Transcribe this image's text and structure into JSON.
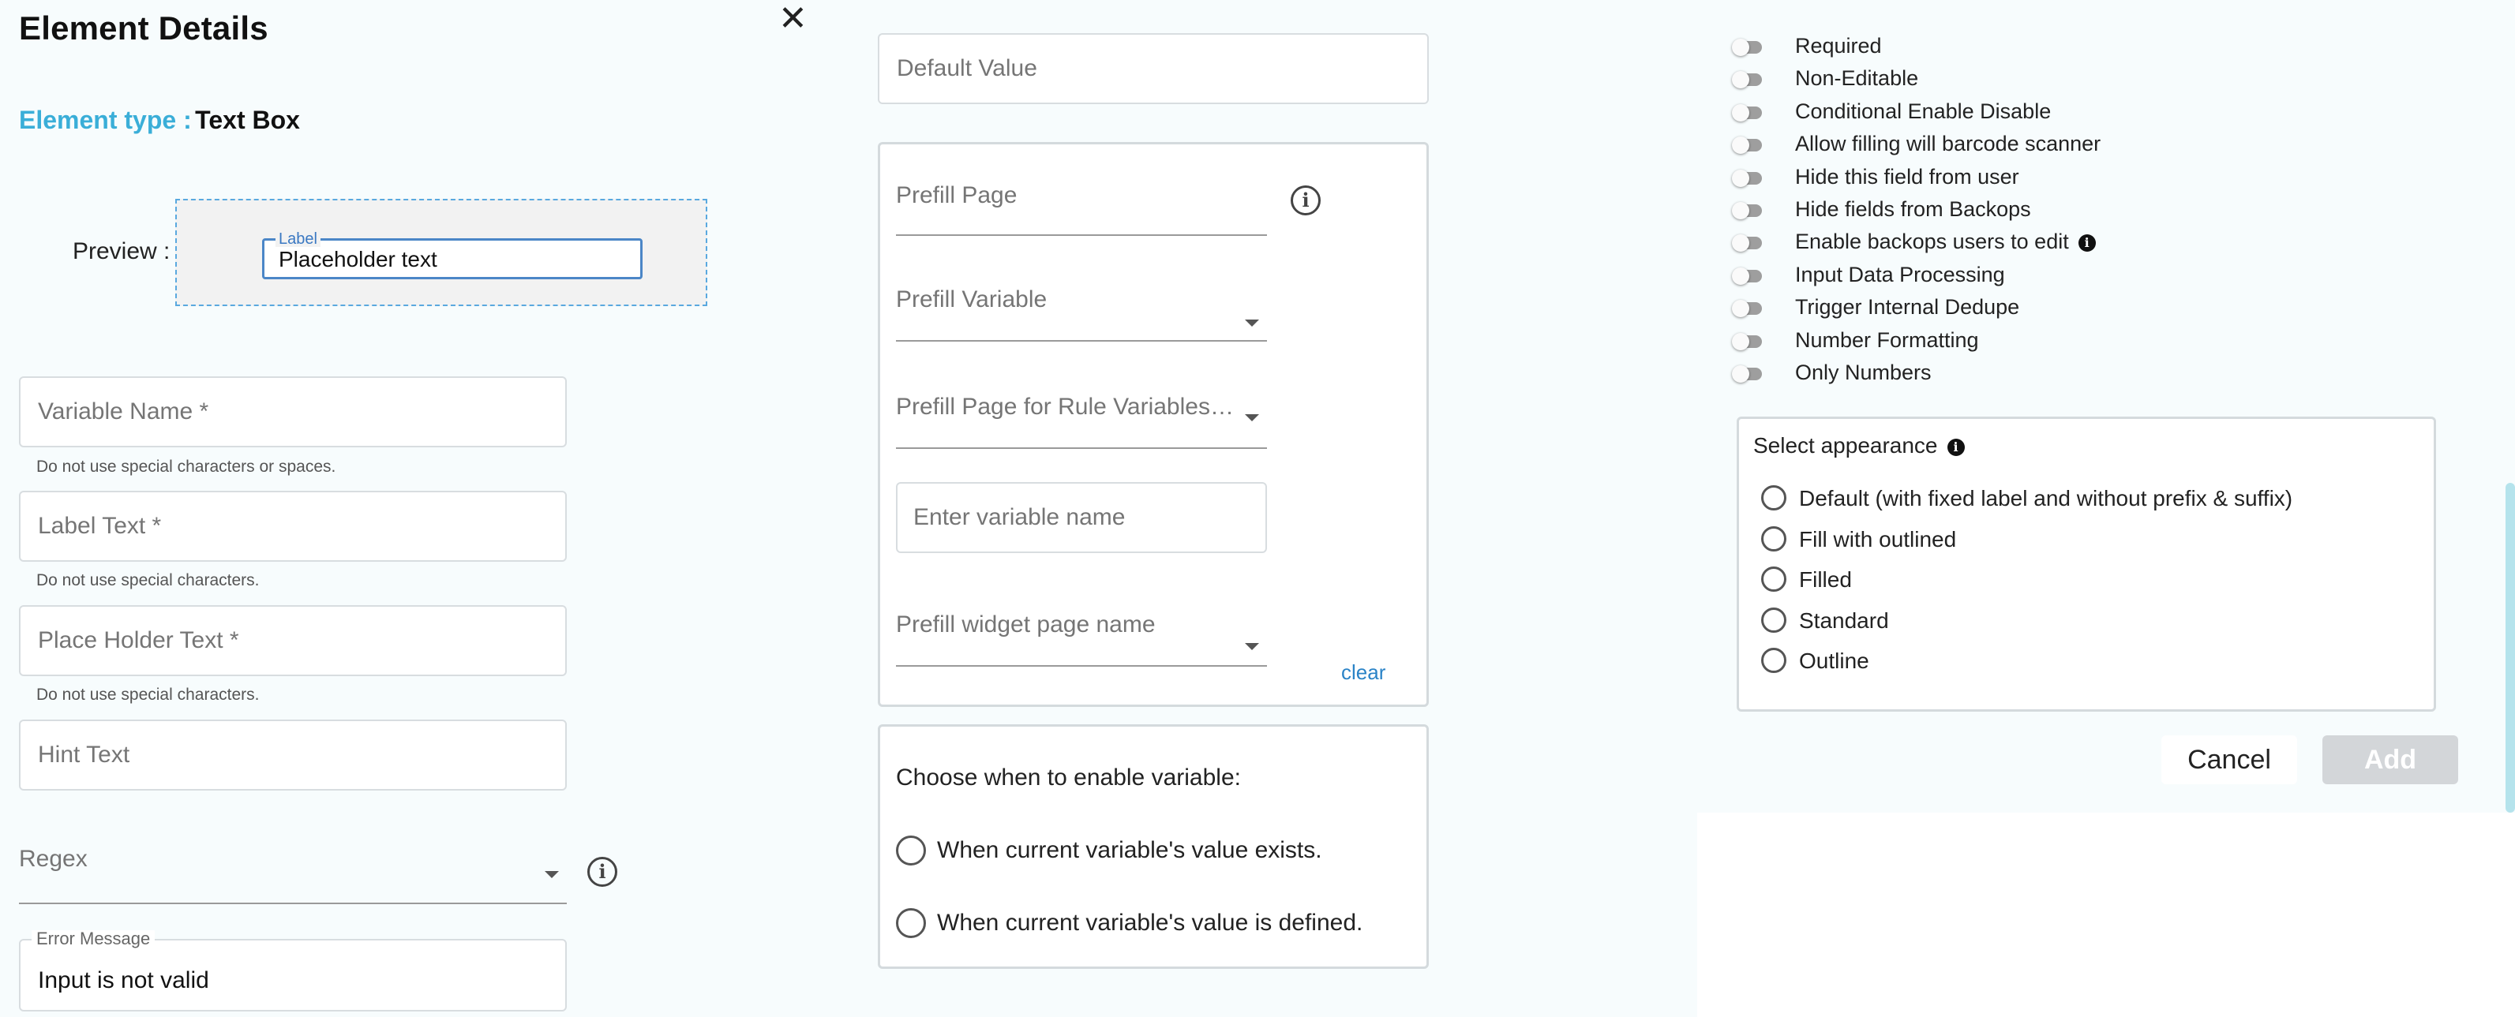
{
  "panel1": {
    "title": "Element Details",
    "close_icon": "close-icon",
    "element_type_label": "Element type :",
    "element_type_value": "Text Box",
    "preview_label": "Preview :",
    "preview_field_legend": "Label",
    "preview_field_value": "Placeholder text",
    "variable_name": {
      "placeholder": "Variable Name *",
      "help": "Do not use special characters or spaces."
    },
    "label_text": {
      "placeholder": "Label Text *",
      "help": "Do not use special characters."
    },
    "placeholder_text": {
      "placeholder": "Place Holder Text *",
      "help": "Do not use special characters."
    },
    "hint_text": {
      "placeholder": "Hint Text"
    },
    "regex": {
      "label": "Regex",
      "info_icon": "info-icon"
    },
    "error_message": {
      "legend": "Error Message",
      "value": "Input is not valid"
    }
  },
  "panel2": {
    "default_value": {
      "placeholder": "Default Value"
    },
    "prefill": {
      "page_label": "Prefill Page",
      "variable_label": "Prefill Variable",
      "rule_page_label": "Prefill Page for Rule Variables(...",
      "enter_variable_placeholder": "Enter variable name",
      "widget_page_label": "Prefill widget page name",
      "clear_link": "clear",
      "info_icon": "info-icon"
    },
    "enable_variable": {
      "title": "Choose when to enable variable:",
      "options": [
        "When current variable's value exists.",
        "When current variable's value is defined."
      ]
    }
  },
  "panel3": {
    "toggles": [
      {
        "label": "Required",
        "on": false
      },
      {
        "label": "Non-Editable",
        "on": false
      },
      {
        "label": "Conditional Enable Disable",
        "on": false
      },
      {
        "label": "Allow filling will barcode scanner",
        "on": false
      },
      {
        "label": "Hide this field from user",
        "on": false
      },
      {
        "label": "Hide fields from Backops",
        "on": false
      },
      {
        "label": "Enable backops users to edit",
        "on": false,
        "info": true
      },
      {
        "label": "Input Data Processing",
        "on": false
      },
      {
        "label": "Trigger Internal Dedupe",
        "on": false
      },
      {
        "label": "Number Formatting",
        "on": false
      },
      {
        "label": "Only Numbers",
        "on": false
      }
    ],
    "appearance": {
      "title": "Select appearance",
      "options": [
        "Default (with fixed label and without prefix & suffix)",
        "Fill with outlined",
        "Filled",
        "Standard",
        "Outline"
      ]
    },
    "cancel_label": "Cancel",
    "add_label": "Add"
  },
  "colors": {
    "accent": "#3aaed8",
    "link": "#2a83c7",
    "panel_bg": "#f7fcfd",
    "scrollbar": "#b5e3ec",
    "disabled_button": "#d3d6d9"
  }
}
